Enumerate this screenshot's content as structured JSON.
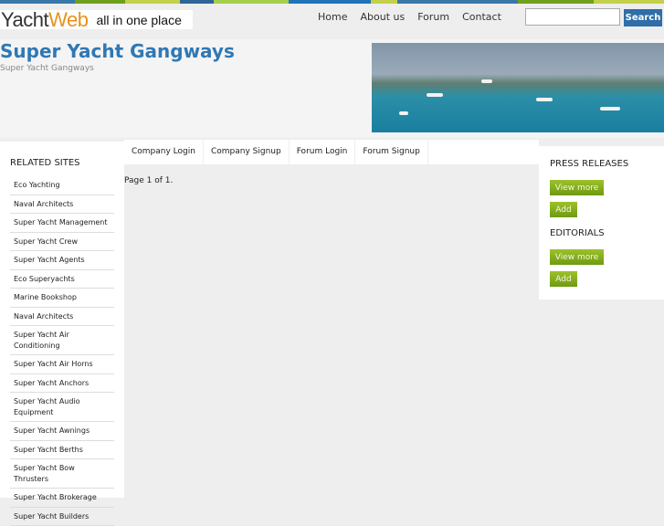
{
  "logo": {
    "part1": "Yacht",
    "part2": "Web",
    "tagline": "all in one place"
  },
  "nav": [
    "Home",
    "About us",
    "Forum",
    "Contact"
  ],
  "search": {
    "value": "",
    "button": "Search"
  },
  "header": {
    "title": "Super Yacht Gangways",
    "subtitle": "Super Yacht Gangways"
  },
  "tabs": [
    "Company Login",
    "Company Signup",
    "Forum Login",
    "Forum Signup"
  ],
  "main": {
    "pagination": "Page 1 of 1."
  },
  "related": {
    "heading": "RELATED SITES",
    "items": [
      "Eco Yachting",
      "Naval Architects",
      "Super Yacht Management",
      "Super Yacht Crew",
      "Super Yacht Agents",
      "Eco Superyachts",
      "Marine Bookshop",
      "Naval Architects",
      "Super Yacht Air Conditioning",
      "Super Yacht Air Horns",
      "Super Yacht Anchors",
      "Super Yacht Audio Equipment",
      "Super Yacht Awnings",
      "Super Yacht Berths",
      "Super Yacht Bow Thrusters",
      "Super Yacht Brokerage",
      "Super Yacht Builders"
    ]
  },
  "press": {
    "heading": "PRESS RELEASES",
    "view": "View more",
    "add": "Add"
  },
  "editorials": {
    "heading": "EDITORIALS",
    "view": "View more",
    "add": "Add"
  }
}
